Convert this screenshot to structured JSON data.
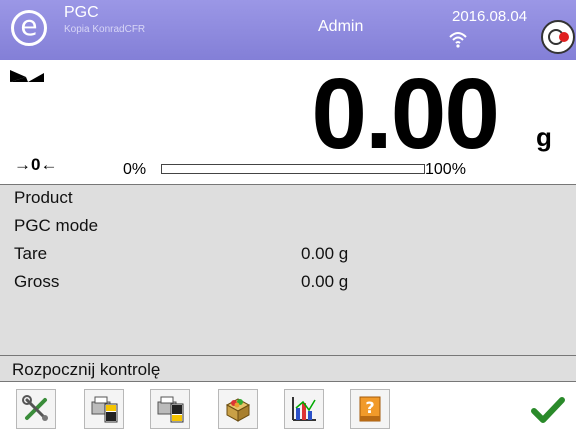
{
  "header": {
    "logo_letter": "e",
    "app_name": "PGC",
    "profile_name": "Kopia KonradCFR",
    "user": "Admin",
    "date": "2016.08.04",
    "accent_color": "#8e8adf"
  },
  "display": {
    "weight": "0.00",
    "unit": "g",
    "zero_symbol": "→0←",
    "bar_min_label": "0%",
    "bar_max_label": "100%",
    "bar_progress_percent": 0
  },
  "info": {
    "product_label": "Product",
    "mode_label": "PGC mode",
    "tare_label": "Tare",
    "tare_value": "0.00 g",
    "gross_label": "Gross",
    "gross_value": "0.00 g"
  },
  "status": {
    "text": "Rozpocznij kontrolę"
  },
  "toolbar": {
    "buttons": [
      {
        "icon": "settings-tools-icon"
      },
      {
        "icon": "print-header-icon"
      },
      {
        "icon": "print-footer-icon"
      },
      {
        "icon": "product-database-icon"
      },
      {
        "icon": "statistics-chart-icon"
      },
      {
        "icon": "help-book-icon"
      }
    ],
    "accept_icon": "checkmark-icon"
  }
}
